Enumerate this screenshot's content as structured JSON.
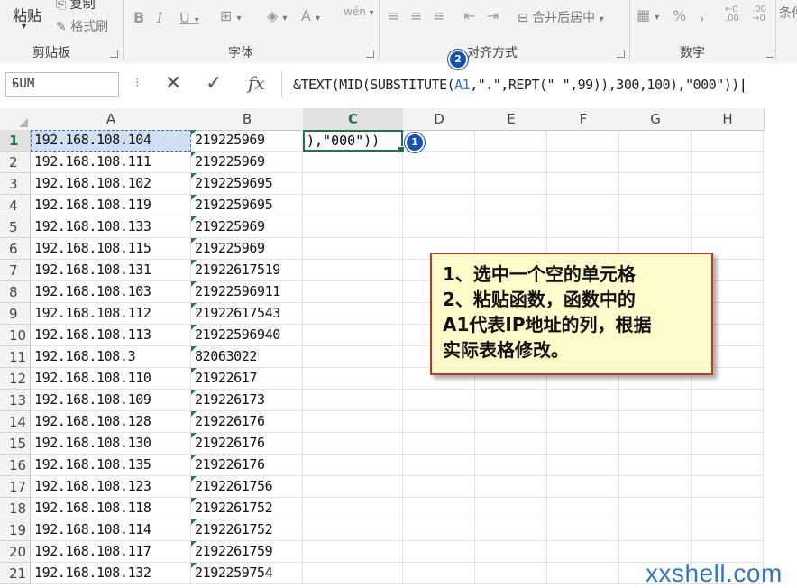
{
  "ribbon": {
    "paste_label": "粘贴",
    "copy_label": "复制",
    "format_painter_label": "格式刷",
    "groups": {
      "clipboard": "剪贴板",
      "font": "字体",
      "alignment": "对齐方式",
      "number": "数字",
      "styles_partial": "条件"
    },
    "merge_label": "合并后居中",
    "percent_symbol": "%",
    "comma_symbol": ","
  },
  "formula_bar": {
    "name_box": "SUM",
    "formula_prefix": "&TEXT(MID(SUBSTITUTE(",
    "formula_ref": "A1",
    "formula_suffix": ",\".\",REPT(\" \",99)),300,100),\"000\"))"
  },
  "grid": {
    "columns": [
      "A",
      "B",
      "C",
      "D",
      "E",
      "F",
      "G",
      "H"
    ],
    "selected_column": "C",
    "rows": [
      {
        "n": "1",
        "a": "192.168.108.104",
        "b": "219225969"
      },
      {
        "n": "2",
        "a": "192.168.108.111",
        "b": "219225969"
      },
      {
        "n": "3",
        "a": "192.168.108.102",
        "b": "2192259695"
      },
      {
        "n": "4",
        "a": "192.168.108.119",
        "b": "2192259695"
      },
      {
        "n": "5",
        "a": "192.168.108.133",
        "b": "219225969"
      },
      {
        "n": "6",
        "a": "192.168.108.115",
        "b": "219225969"
      },
      {
        "n": "7",
        "a": "192.168.108.131",
        "b": "21922617519"
      },
      {
        "n": "8",
        "a": "192.168.108.103",
        "b": "21922596911"
      },
      {
        "n": "9",
        "a": "192.168.108.112",
        "b": "21922617543"
      },
      {
        "n": "10",
        "a": "192.168.108.113",
        "b": "21922596940"
      },
      {
        "n": "11",
        "a": "192.168.108.3",
        "b": "82063022"
      },
      {
        "n": "12",
        "a": "192.168.108.110",
        "b": "21922617"
      },
      {
        "n": "13",
        "a": "192.168.108.109",
        "b": "219226173"
      },
      {
        "n": "14",
        "a": "192.168.108.128",
        "b": "219226176"
      },
      {
        "n": "15",
        "a": "192.168.108.130",
        "b": "219226176"
      },
      {
        "n": "16",
        "a": "192.168.108.135",
        "b": "219226176"
      },
      {
        "n": "17",
        "a": "192.168.108.123",
        "b": "2192261756"
      },
      {
        "n": "18",
        "a": "192.168.108.118",
        "b": "2192261752"
      },
      {
        "n": "19",
        "a": "192.168.108.114",
        "b": "2192261752"
      },
      {
        "n": "20",
        "a": "192.168.108.117",
        "b": "2192261759"
      },
      {
        "n": "21",
        "a": "192.168.108.132",
        "b": "2192259754"
      }
    ],
    "c1_value": "),\"000\"))"
  },
  "badges": {
    "one": "1",
    "two": "2"
  },
  "note": {
    "line1": "1、选中一个空的单元格",
    "line2": "2、粘贴函数，函数中的",
    "line3": "A1代表IP地址的列，根据",
    "line4": "实际表格修改。"
  },
  "watermark": "xxshell.com",
  "colors": {
    "accent_green": "#217346",
    "badge_blue": "#1a4fb5",
    "note_border": "#c0392b",
    "note_bg": "#fffbcb"
  }
}
